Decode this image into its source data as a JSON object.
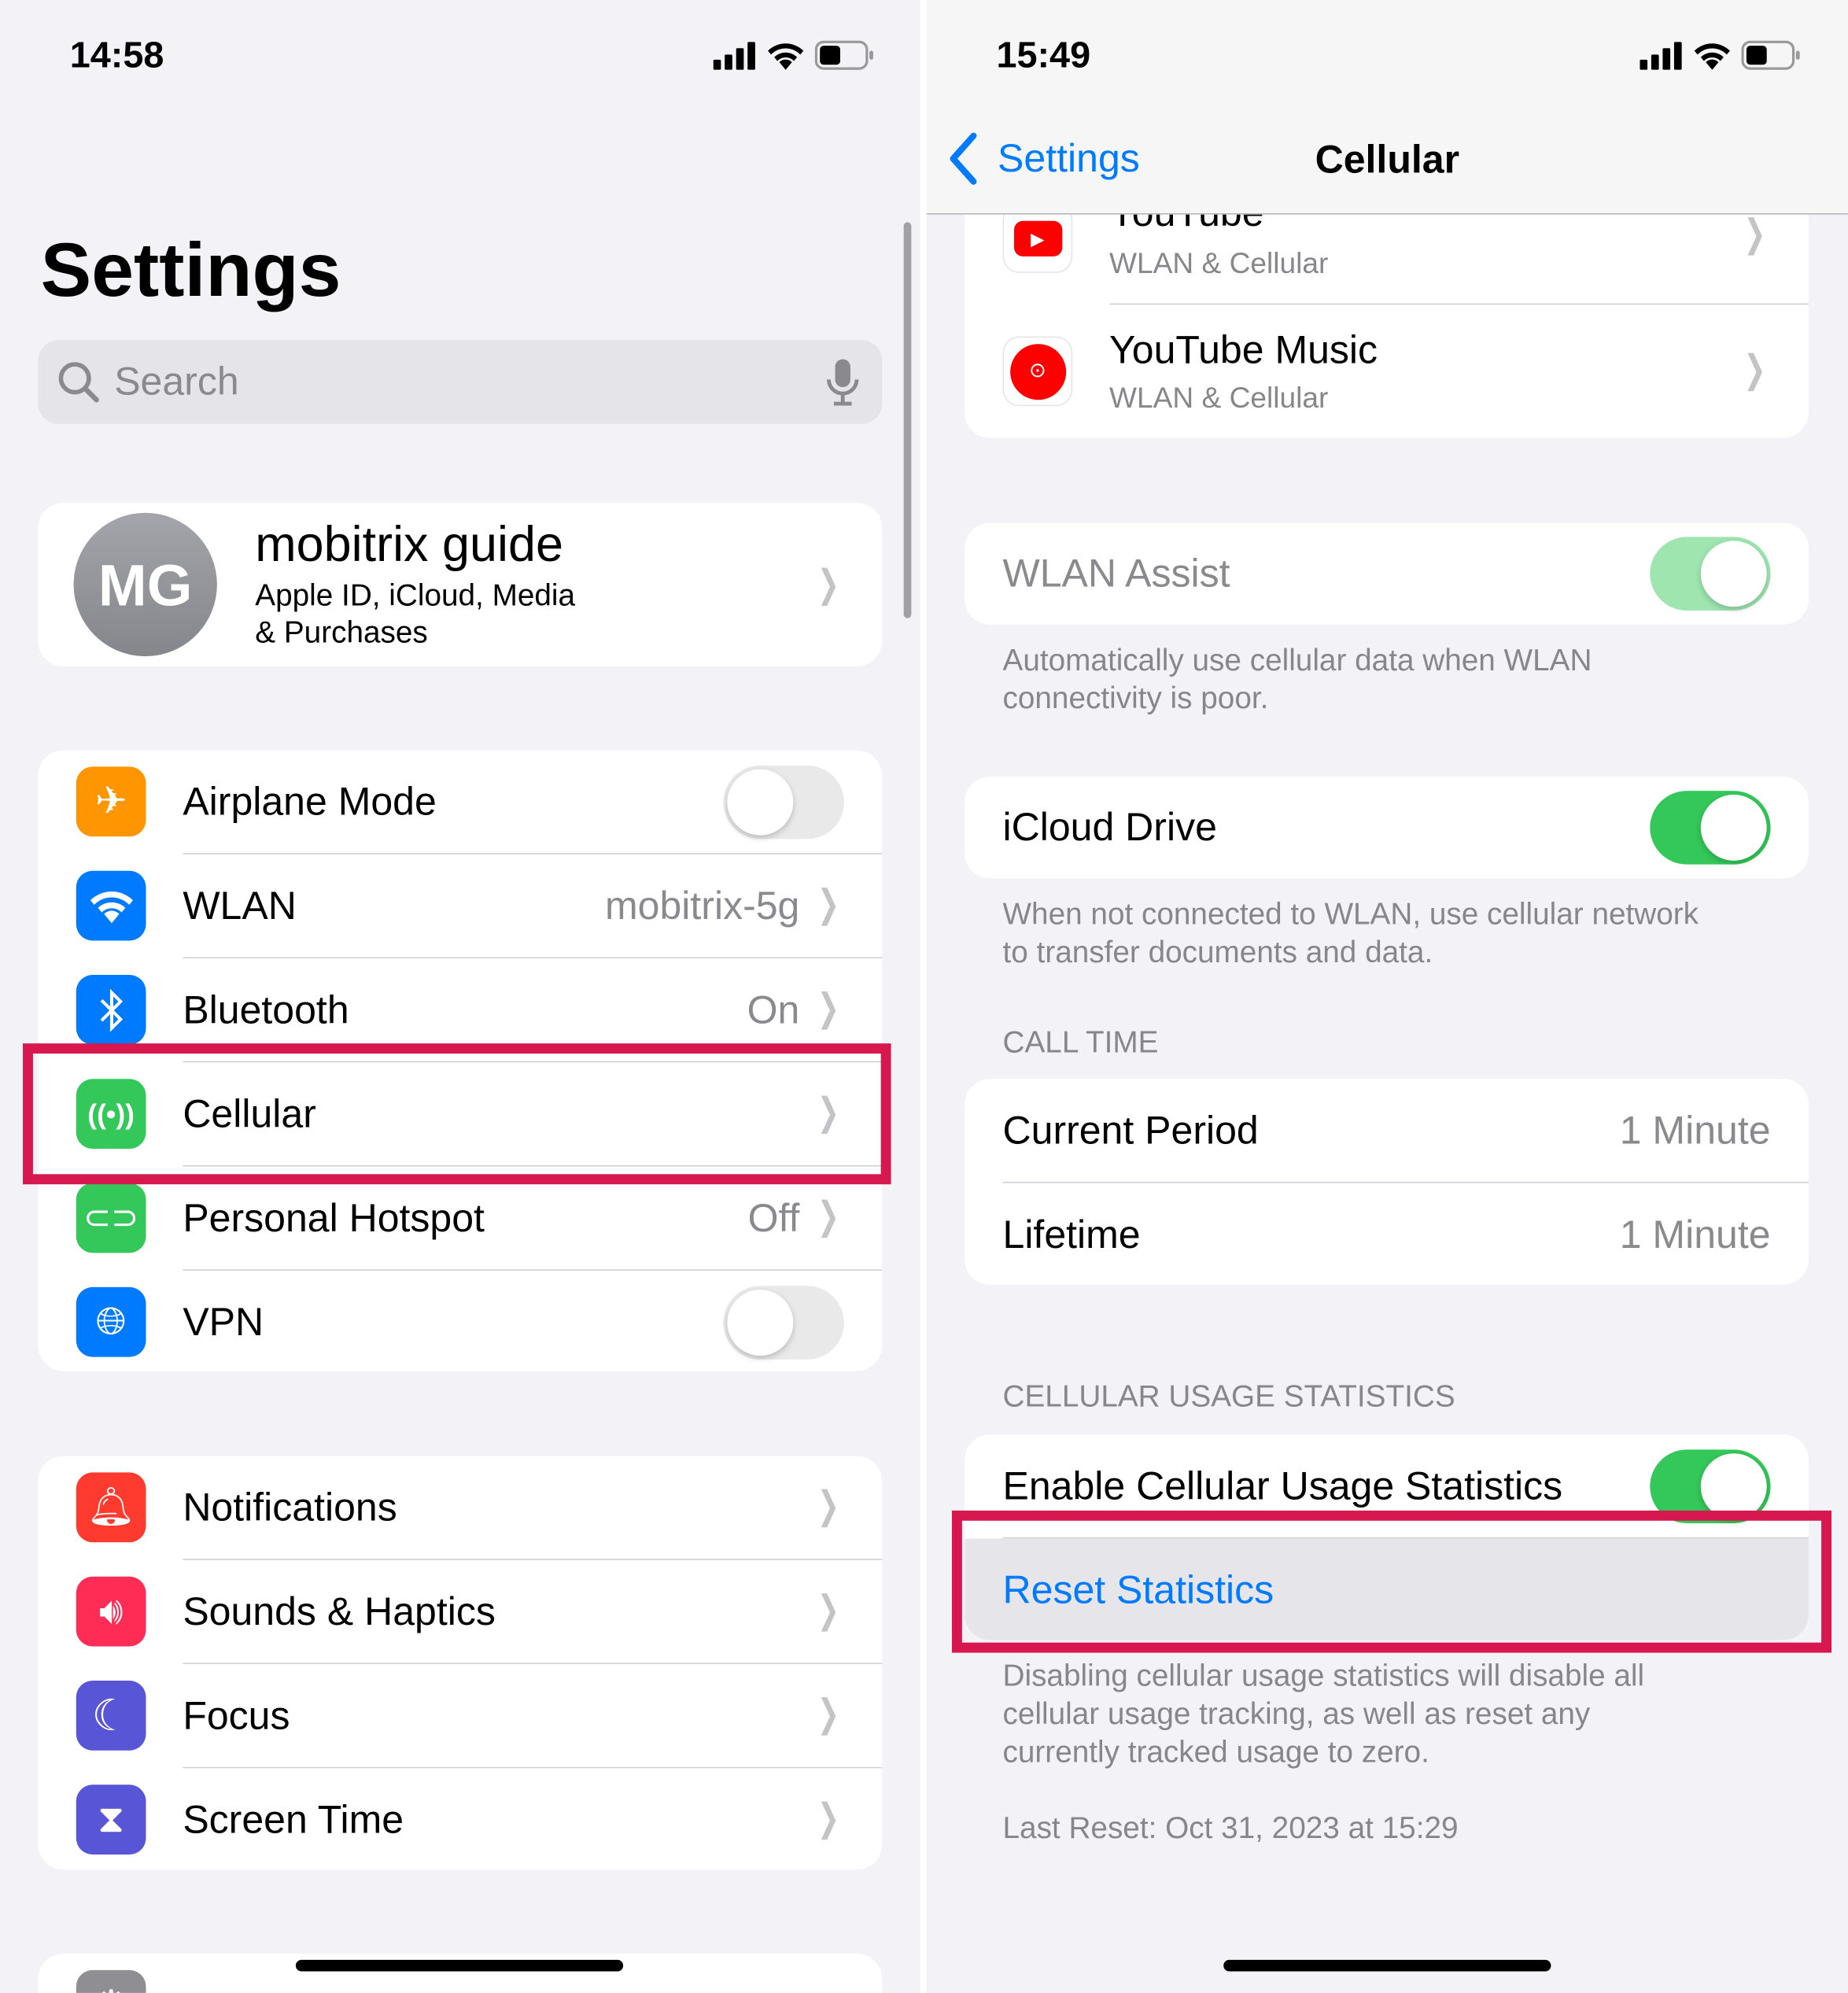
{
  "left": {
    "status": {
      "time": "14:58"
    },
    "title": "Settings",
    "search": {
      "placeholder": "Search"
    },
    "profile": {
      "initials": "MG",
      "name": "mobitrix guide",
      "subtitle_line1": "Apple ID, iCloud, Media",
      "subtitle_line2": "& Purchases"
    },
    "connectivity": [
      {
        "label": "Airplane Mode",
        "toggle": false,
        "color": "#ff9500",
        "icon": "airplane-icon"
      },
      {
        "label": "WLAN",
        "value": "mobitrix-5g",
        "color": "#007aff",
        "icon": "wifi-icon"
      },
      {
        "label": "Bluetooth",
        "value": "On",
        "color": "#007aff",
        "icon": "bluetooth-icon"
      },
      {
        "label": "Cellular",
        "color": "#34c759",
        "icon": "antenna-icon",
        "highlighted": true
      },
      {
        "label": "Personal Hotspot",
        "value": "Off",
        "color": "#34c759",
        "icon": "hotspot-icon"
      },
      {
        "label": "VPN",
        "toggle": false,
        "color": "#007aff",
        "icon": "globe-icon"
      }
    ],
    "general": [
      {
        "label": "Notifications",
        "color": "#ff3b30",
        "icon": "bell-icon"
      },
      {
        "label": "Sounds & Haptics",
        "color": "#ff2d55",
        "icon": "speaker-icon"
      },
      {
        "label": "Focus",
        "color": "#5856d6",
        "icon": "moon-icon"
      },
      {
        "label": "Screen Time",
        "color": "#5856d6",
        "icon": "hourglass-icon"
      }
    ]
  },
  "right": {
    "status": {
      "time": "15:49"
    },
    "nav": {
      "back_label": "Settings",
      "title": "Cellular"
    },
    "apps": [
      {
        "name": "YouTube",
        "subtitle": "WLAN & Cellular"
      },
      {
        "name": "YouTube Music",
        "subtitle": "WLAN & Cellular"
      }
    ],
    "wlan_assist": {
      "label": "WLAN Assist",
      "toggle": true,
      "footer": [
        "Automatically use cellular data when WLAN",
        "connectivity is poor."
      ]
    },
    "icloud_drive": {
      "label": "iCloud Drive",
      "toggle": true,
      "footer": [
        "When not connected to WLAN, use cellular network",
        "to transfer documents and data."
      ]
    },
    "call_time": {
      "header": "CALL TIME",
      "rows": [
        {
          "label": "Current Period",
          "value": "1 Minute"
        },
        {
          "label": "Lifetime",
          "value": "1 Minute"
        }
      ]
    },
    "usage_stats": {
      "header": "CELLULAR USAGE STATISTICS",
      "enable_label": "Enable Cellular Usage Statistics",
      "toggle": true,
      "reset_label": "Reset Statistics",
      "footer": [
        "Disabling cellular usage statistics will disable all",
        "cellular usage tracking, as well as reset any",
        "currently tracked usage to zero."
      ],
      "last_reset": "Last Reset: Oct 31, 2023 at 15:29"
    },
    "accent": "#007aff"
  }
}
